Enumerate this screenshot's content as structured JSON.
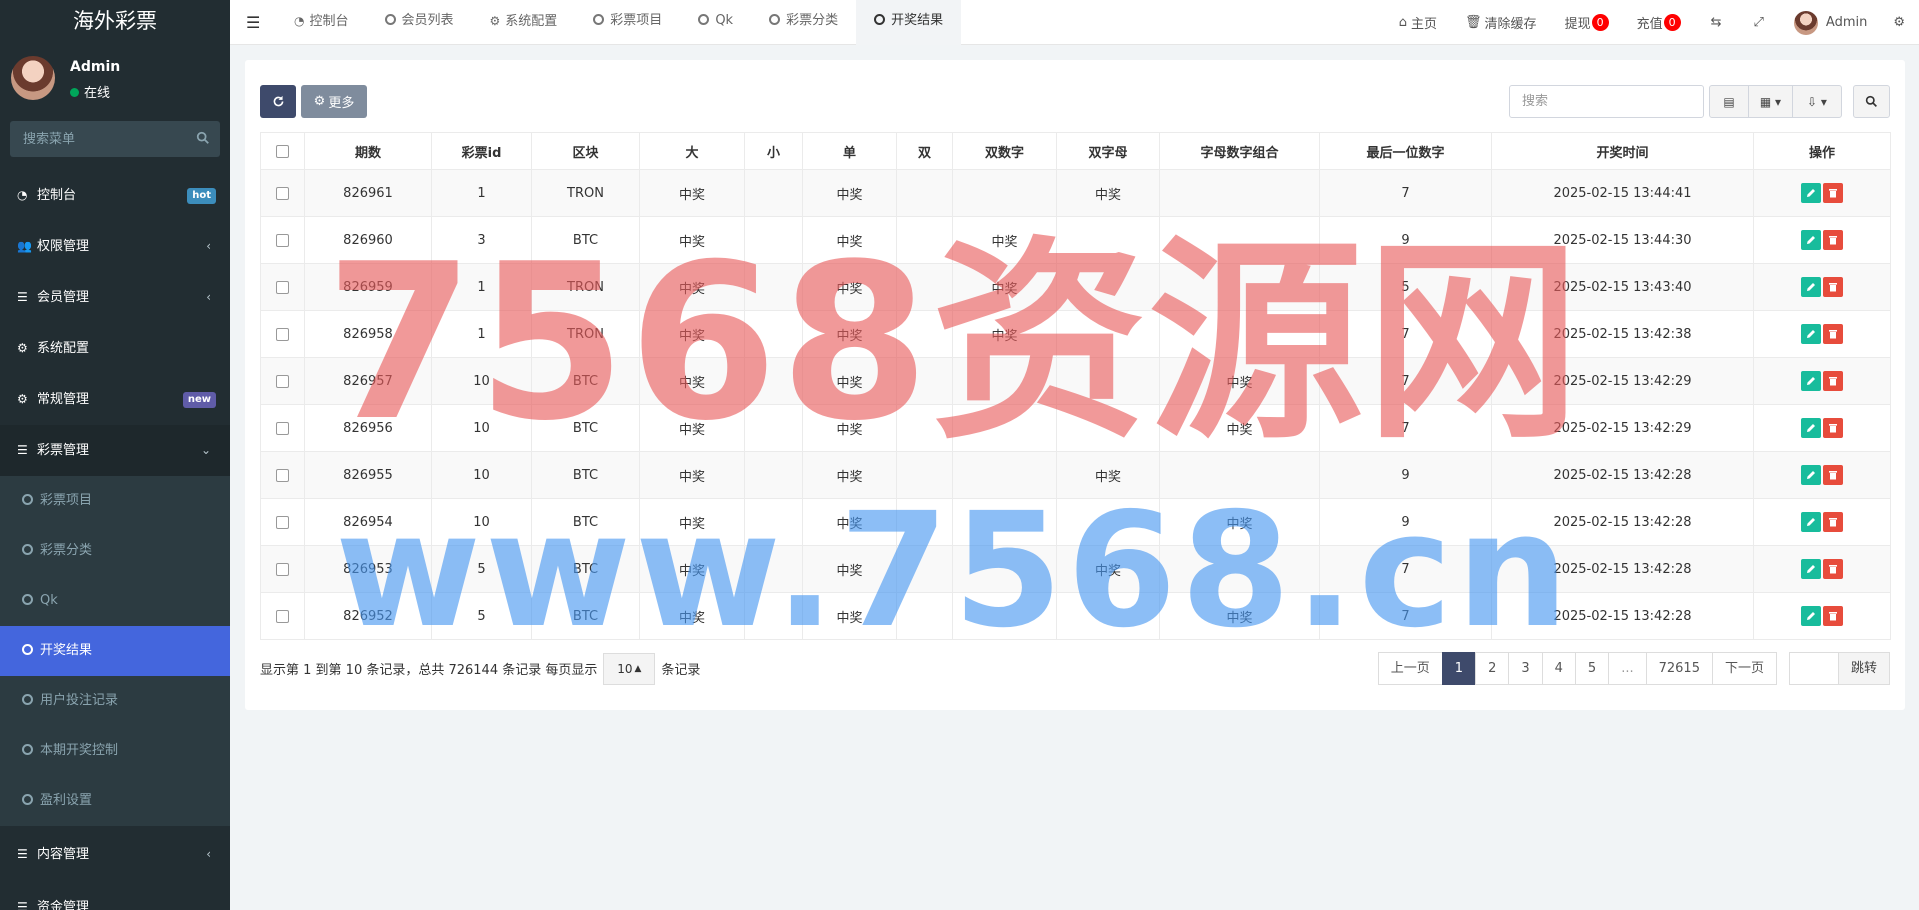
{
  "app": {
    "title": "海外彩票"
  },
  "user": {
    "name": "Admin",
    "status": "在线"
  },
  "sidebar": {
    "search_placeholder": "搜索菜单",
    "items": [
      {
        "label": "控制台",
        "icon": "dashboard-icon",
        "badge": "hot",
        "badge_color": "#3c8dbc"
      },
      {
        "label": "权限管理",
        "icon": "users-icon",
        "caret": "‹"
      },
      {
        "label": "会员管理",
        "icon": "list-icon",
        "caret": "‹"
      },
      {
        "label": "系统配置",
        "icon": "gear-icon"
      },
      {
        "label": "常规管理",
        "icon": "cogs-icon",
        "badge": "new",
        "badge_color": "#605ca8"
      },
      {
        "label": "彩票管理",
        "icon": "list-icon",
        "caret": "⌄"
      }
    ],
    "subitems": [
      {
        "label": "彩票项目"
      },
      {
        "label": "彩票分类"
      },
      {
        "label": "Qk"
      },
      {
        "label": "开奖结果"
      },
      {
        "label": "用户投注记录"
      },
      {
        "label": "本期开奖控制"
      },
      {
        "label": "盈利设置"
      }
    ],
    "after_items": [
      {
        "label": "内容管理",
        "icon": "list-icon",
        "caret": "‹"
      },
      {
        "label": "资金管理",
        "icon": "list-icon"
      }
    ]
  },
  "tabs": [
    {
      "label": "控制台",
      "icon": "dashboard-icon"
    },
    {
      "label": "会员列表",
      "icon": "circle-icon"
    },
    {
      "label": "系统配置",
      "icon": "gear-icon"
    },
    {
      "label": "彩票项目",
      "icon": "circle-icon"
    },
    {
      "label": "Qk",
      "icon": "circle-icon"
    },
    {
      "label": "彩票分类",
      "icon": "circle-icon"
    },
    {
      "label": "开奖结果",
      "icon": "circle-icon"
    }
  ],
  "topright": {
    "home": "主页",
    "clear_cache": "清除缓存",
    "withdraw": "提现",
    "withdraw_count": "0",
    "recharge": "充值",
    "recharge_count": "0",
    "admin": "Admin"
  },
  "toolbar": {
    "more_label": "更多",
    "search_placeholder": "搜索"
  },
  "table": {
    "columns": [
      "期数",
      "彩票id",
      "区块",
      "大",
      "小",
      "单",
      "双",
      "双数字",
      "双字母",
      "字母数字组合",
      "最后一位数字",
      "开奖时间",
      "操作"
    ],
    "rows": [
      [
        "826961",
        "1",
        "TRON",
        "中奖",
        "",
        "中奖",
        "",
        "",
        "中奖",
        "",
        "7",
        "2025-02-15 13:44:41"
      ],
      [
        "826960",
        "3",
        "BTC",
        "中奖",
        "",
        "中奖",
        "",
        "中奖",
        "",
        "",
        "9",
        "2025-02-15 13:44:30"
      ],
      [
        "826959",
        "1",
        "TRON",
        "中奖",
        "",
        "中奖",
        "",
        "中奖",
        "",
        "",
        "5",
        "2025-02-15 13:43:40"
      ],
      [
        "826958",
        "1",
        "TRON",
        "中奖",
        "",
        "中奖",
        "",
        "中奖",
        "",
        "",
        "7",
        "2025-02-15 13:42:38"
      ],
      [
        "826957",
        "10",
        "BTC",
        "中奖",
        "",
        "中奖",
        "",
        "",
        "",
        "中奖",
        "7",
        "2025-02-15 13:42:29"
      ],
      [
        "826956",
        "10",
        "BTC",
        "中奖",
        "",
        "中奖",
        "",
        "",
        "",
        "中奖",
        "7",
        "2025-02-15 13:42:29"
      ],
      [
        "826955",
        "10",
        "BTC",
        "中奖",
        "",
        "中奖",
        "",
        "",
        "中奖",
        "",
        "9",
        "2025-02-15 13:42:28"
      ],
      [
        "826954",
        "10",
        "BTC",
        "中奖",
        "",
        "中奖",
        "",
        "",
        "",
        "中奖",
        "9",
        "2025-02-15 13:42:28"
      ],
      [
        "826953",
        "5",
        "BTC",
        "中奖",
        "",
        "中奖",
        "",
        "",
        "中奖",
        "",
        "7",
        "2025-02-15 13:42:28"
      ],
      [
        "826952",
        "5",
        "BTC",
        "中奖",
        "",
        "中奖",
        "",
        "",
        "",
        "中奖",
        "7",
        "2025-02-15 13:42:28"
      ]
    ]
  },
  "pager": {
    "info_prefix": "显示第 1 到第 10 条记录，总共 726144 条记录 每页显示",
    "page_size": "10",
    "info_suffix": "条记录",
    "prev": "上一页",
    "pages": [
      "1",
      "2",
      "3",
      "4",
      "5",
      "...",
      "72615"
    ],
    "next": "下一页",
    "jump": "跳转"
  },
  "watermark": {
    "line1": "7568资源网",
    "line2": "www.7568.cn"
  }
}
